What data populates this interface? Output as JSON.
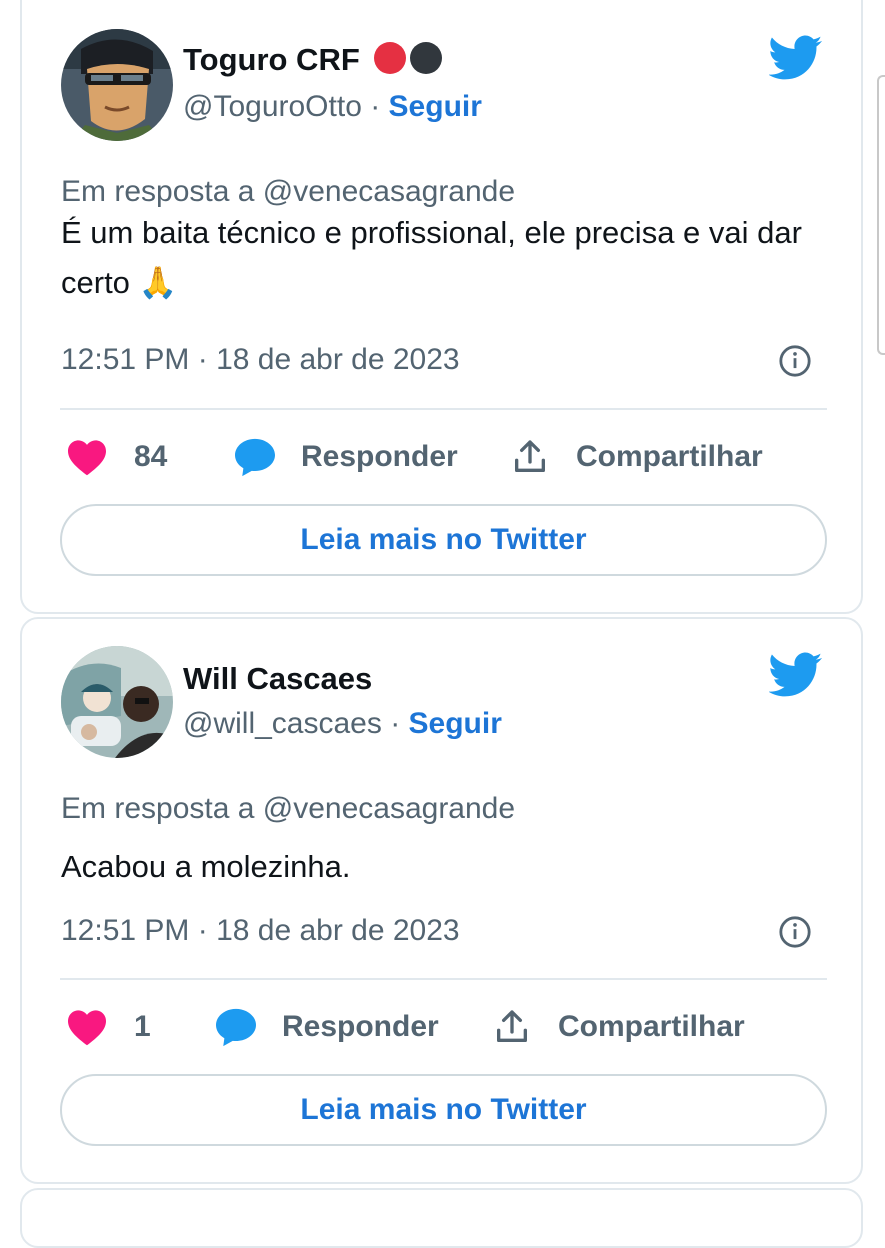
{
  "tweets": [
    {
      "author_name": "Toguro CRF",
      "handle": "@ToguroOtto",
      "separator": " · ",
      "follow_label": "Seguir",
      "reply_to": "Em resposta a @venecasagrande",
      "text": "É um baita técnico e profissional, ele precisa e vai dar certo 🙏",
      "timestamp": "12:51 PM · 18 de abr de 2023",
      "likes": "84",
      "reply_label": "Responder",
      "share_label": "Compartilhar",
      "read_more_label": "Leia mais no Twitter",
      "badges": [
        "red-circle-emoji",
        "black-circle-emoji"
      ]
    },
    {
      "author_name": "Will Cascaes",
      "handle": "@will_cascaes",
      "separator": " · ",
      "follow_label": "Seguir",
      "reply_to": "Em resposta a @venecasagrande",
      "text": "Acabou a molezinha.",
      "timestamp": "12:51 PM · 18 de abr de 2023",
      "likes": "1",
      "reply_label": "Responder",
      "share_label": "Compartilhar",
      "read_more_label": "Leia mais no Twitter"
    }
  ],
  "colors": {
    "accent": "#1d75d6",
    "twitter_blue": "#1d9bf0",
    "like_pink": "#f91880",
    "muted_text": "#536471",
    "border": "#e1e8ed"
  },
  "icons": [
    "twitter-bird-icon",
    "heart-icon",
    "reply-bubble-icon",
    "share-icon",
    "info-icon"
  ]
}
